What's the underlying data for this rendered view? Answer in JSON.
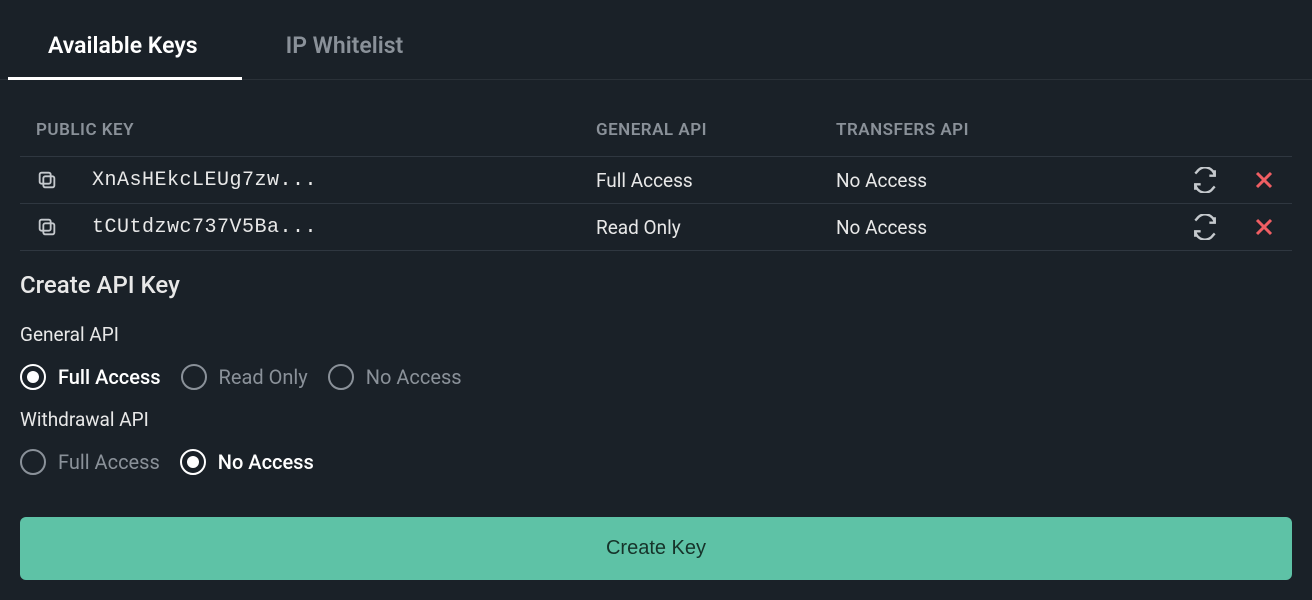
{
  "tabs": [
    {
      "label": "Available Keys",
      "active": true
    },
    {
      "label": "IP Whitelist",
      "active": false
    }
  ],
  "table": {
    "headers": {
      "public_key": "PUBLIC KEY",
      "general_api": "GENERAL API",
      "transfers_api": "TRANSFERS API"
    },
    "rows": [
      {
        "public_key": "XnAsHEkcLEUg7zw...",
        "general_api": "Full Access",
        "transfers_api": "No Access"
      },
      {
        "public_key": "tCUtdzwc737V5Ba...",
        "general_api": "Read Only",
        "transfers_api": "No Access"
      }
    ]
  },
  "create": {
    "title": "Create API Key",
    "groups": [
      {
        "label": "General API",
        "options": [
          {
            "label": "Full Access",
            "selected": true
          },
          {
            "label": "Read Only",
            "selected": false
          },
          {
            "label": "No Access",
            "selected": false
          }
        ]
      },
      {
        "label": "Withdrawal API",
        "options": [
          {
            "label": "Full Access",
            "selected": false
          },
          {
            "label": "No Access",
            "selected": true
          }
        ]
      }
    ],
    "button_label": "Create Key"
  }
}
